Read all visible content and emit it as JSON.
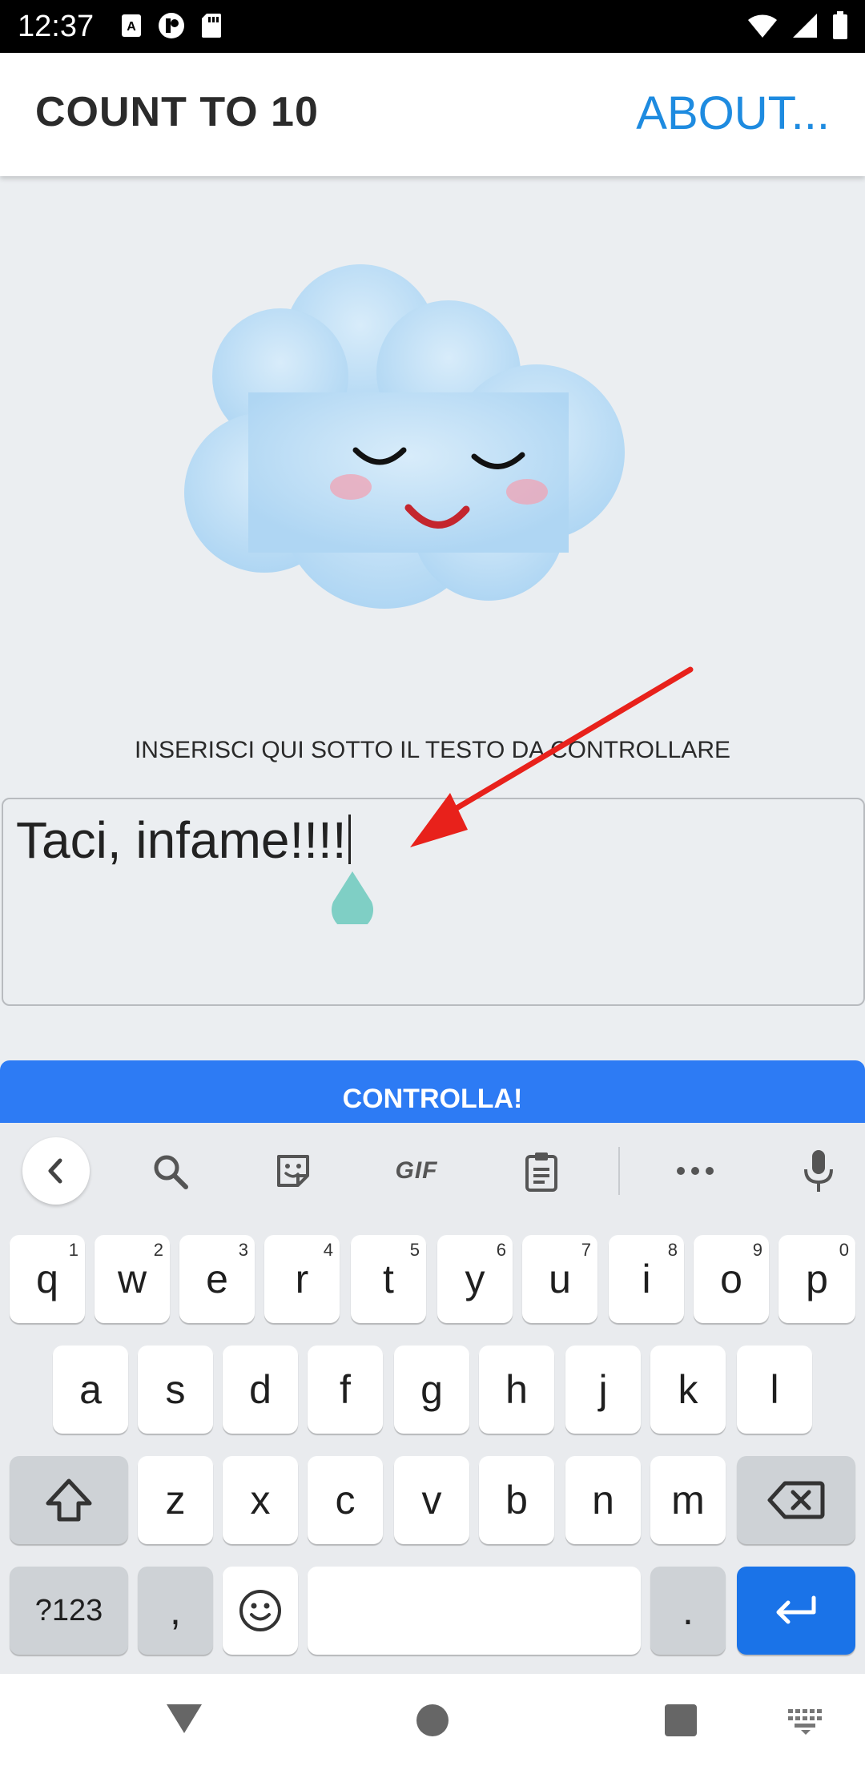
{
  "status": {
    "time": "12:37"
  },
  "app": {
    "title": "COUNT TO 10",
    "about": "ABOUT..."
  },
  "main": {
    "instruction": "INSERISCI QUI SOTTO IL TESTO DA CONTROLLARE",
    "input_value": "Taci, infame!!!!",
    "button_label": "CONTROLLA!"
  },
  "keyboard": {
    "toolbar": {
      "gif": "GIF"
    },
    "row1": [
      {
        "label": "q",
        "hint": "1"
      },
      {
        "label": "w",
        "hint": "2"
      },
      {
        "label": "e",
        "hint": "3"
      },
      {
        "label": "r",
        "hint": "4"
      },
      {
        "label": "t",
        "hint": "5"
      },
      {
        "label": "y",
        "hint": "6"
      },
      {
        "label": "u",
        "hint": "7"
      },
      {
        "label": "i",
        "hint": "8"
      },
      {
        "label": "o",
        "hint": "9"
      },
      {
        "label": "p",
        "hint": "0"
      }
    ],
    "row2": [
      "a",
      "s",
      "d",
      "f",
      "g",
      "h",
      "j",
      "k",
      "l"
    ],
    "row3": [
      "z",
      "x",
      "c",
      "v",
      "b",
      "n",
      "m"
    ],
    "symbols": "?123",
    "comma": ",",
    "period": "."
  },
  "colors": {
    "accent": "#1E8BE0",
    "button": "#2D7BF4",
    "enter": "#1A73E8",
    "arrow": "#E8211B"
  }
}
